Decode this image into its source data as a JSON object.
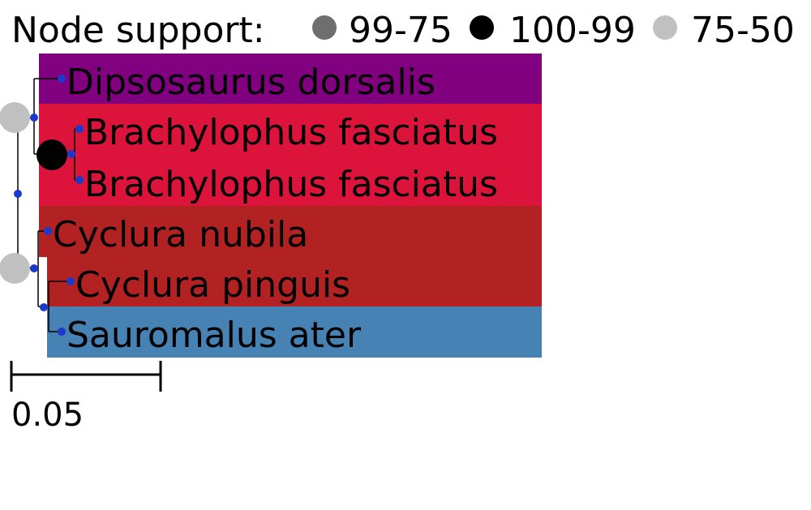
{
  "legend": {
    "title": "Node support:",
    "items": [
      {
        "label": "99-75",
        "color": "#6e6e6e"
      },
      {
        "label": "100-99",
        "color": "#000000"
      },
      {
        "label": "75-50",
        "color": "#c0c0c0"
      }
    ]
  },
  "taxa": [
    {
      "name": "Dipsosaurus dorsalis",
      "bg": "#800080"
    },
    {
      "name": "Brachylophus fasciatus",
      "bg": "#dc143c"
    },
    {
      "name": "Brachylophus fasciatus",
      "bg": "#dc143c"
    },
    {
      "name": "Cyclura nubila",
      "bg": "#b22222"
    },
    {
      "name": "Cyclura pinguis",
      "bg": "#b22222"
    },
    {
      "name": "Sauromalus ater",
      "bg": "#4682b4"
    }
  ],
  "scale_bar": {
    "label": "0.05"
  },
  "colors": {
    "node_dot": "#1a3acc",
    "branch": "#000000"
  }
}
